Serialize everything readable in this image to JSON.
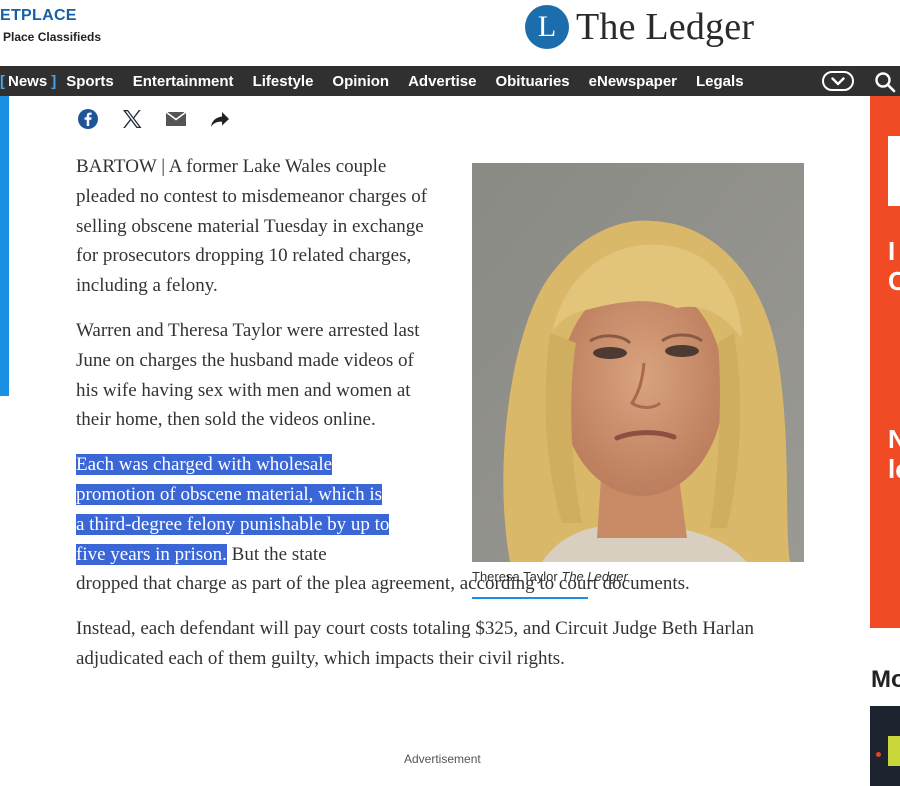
{
  "marketplace": {
    "title": "ETPLACE",
    "subtitle": "Place Classifieds"
  },
  "brand": {
    "logo_letter": "L",
    "name": "The Ledger",
    "logo_color": "#1b6dab"
  },
  "nav": {
    "items": [
      {
        "label": "News",
        "active": true
      },
      {
        "label": "Sports"
      },
      {
        "label": "Entertainment"
      },
      {
        "label": "Lifestyle"
      },
      {
        "label": "Opinion"
      },
      {
        "label": "Advertise"
      },
      {
        "label": "Obituaries"
      },
      {
        "label": "eNewspaper"
      },
      {
        "label": "Legals"
      }
    ],
    "bracket_left": "[",
    "bracket_right": "]",
    "more_icon": "chevron-down-icon",
    "search_icon": "search-icon",
    "background": "#303030",
    "accent": "#4aa3e8"
  },
  "share": {
    "icons": [
      "facebook-icon",
      "x-icon",
      "email-icon",
      "share-icon"
    ]
  },
  "article": {
    "paragraphs": [
      "BARTOW | A former Lake Wales couple pleaded no contest to misdemeanor charges of selling obscene material Tuesday in exchange for prosecutors dropping 10 related charges, including a felony.",
      "Warren and Theresa Taylor were arrested last June on charges the husband made videos of his wife having sex with men and women at their home, then sold the videos online."
    ],
    "p3_highlight_lines": [
      "Each was charged with wholesale",
      "promotion of obscene material, which is",
      "a third-degree felony punishable by up to",
      "five years in prison."
    ],
    "p3_rest_first": "But the state",
    "p3_rest_second": "dropped that charge as part of the plea agreement, according to court documents.",
    "p4": "Instead, each defendant will pay court costs totaling $325, and Circuit Judge Beth Harlan adjudicated each of them guilty, which impacts their civil rights.",
    "highlight_color": "#3a66d6"
  },
  "photo": {
    "caption_name": "Theresa Taylor",
    "caption_credit": "The Ledger"
  },
  "sidebar": {
    "more_label": "Mo",
    "ad_color": "#f04b24",
    "ad_letters": [
      "I",
      "C",
      "N",
      "le"
    ]
  },
  "advertisement_label": "Advertisement"
}
